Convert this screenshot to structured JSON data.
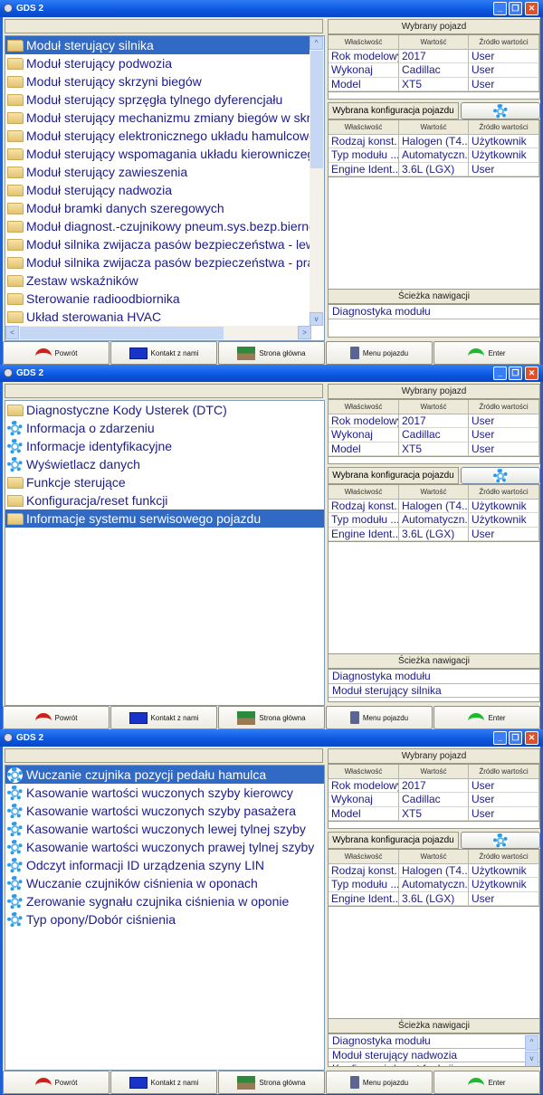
{
  "windows": [
    {
      "title": "GDS 2",
      "list_items": [
        {
          "label": "Moduł sterujący silnika",
          "icon": "folder-icon",
          "selected": true
        },
        {
          "label": "Moduł sterujący podwozia",
          "icon": "folder-icon"
        },
        {
          "label": "Moduł sterujący skrzyni biegów",
          "icon": "folder-icon"
        },
        {
          "label": "Moduł sterujący sprzęgła tylnego dyferencjału",
          "icon": "folder-icon"
        },
        {
          "label": "Moduł sterujący mechanizmu zmiany biegów w skrzyni",
          "icon": "folder-icon"
        },
        {
          "label": "Moduł sterujący elektronicznego układu hamulcowego",
          "icon": "folder-icon"
        },
        {
          "label": "Moduł sterujący wspomagania układu kierowniczego",
          "icon": "folder-icon"
        },
        {
          "label": "Moduł sterujący zawieszenia",
          "icon": "folder-icon"
        },
        {
          "label": "Moduł sterujący nadwozia",
          "icon": "folder-icon"
        },
        {
          "label": "Moduł bramki danych szeregowych",
          "icon": "folder-icon"
        },
        {
          "label": "Moduł diagnost.-czujnikowy pneum.sys.bezp.biernego",
          "icon": "folder-icon"
        },
        {
          "label": "Moduł silnika zwijacza pasów bezpieczeństwa - lewy",
          "icon": "folder-icon"
        },
        {
          "label": "Moduł silnika zwijacza pasów bezpieczeństwa - prawy",
          "icon": "folder-icon"
        },
        {
          "label": "Zestaw wskaźników",
          "icon": "folder-icon"
        },
        {
          "label": "Sterowanie radioodbiornika",
          "icon": "folder-icon"
        },
        {
          "label": "Układ sterowania HVAC",
          "icon": "folder-icon"
        }
      ],
      "scrollbars": true,
      "path_items": [
        "Diagnostyka modułu"
      ],
      "tooltip": ""
    },
    {
      "title": "GDS 2",
      "list_items": [
        {
          "label": "Diagnostyczne Kody Usterek (DTC)",
          "icon": "folder-icon"
        },
        {
          "label": "Informacja o zdarzeniu",
          "icon": "gear-icon"
        },
        {
          "label": "Informacje identyfikacyjne",
          "icon": "gear-icon"
        },
        {
          "label": "Wyświetlacz danych",
          "icon": "gear-icon"
        },
        {
          "label": "Funkcje sterujące",
          "icon": "folder-icon"
        },
        {
          "label": "Konfiguracja/reset funkcji",
          "icon": "folder-icon"
        },
        {
          "label": "Informacje systemu serwisowego pojazdu",
          "icon": "folder-icon",
          "selected": true
        }
      ],
      "scrollbars": false,
      "path_items": [
        "Diagnostyka modułu",
        "Moduł sterujący silnika"
      ],
      "tooltip": "GDS 2"
    },
    {
      "title": "GDS 2",
      "list_items": [
        {
          "label": "Wuczanie czujnika pozycji pedału hamulca",
          "icon": "gear-icon",
          "selected": true
        },
        {
          "label": "Kasowanie wartości wuczonych szyby kierowcy",
          "icon": "gear-icon"
        },
        {
          "label": "Kasowanie wartości wuczonych szyby pasażera",
          "icon": "gear-icon"
        },
        {
          "label": "Kasowanie wartości wuczonych lewej tylnej szyby",
          "icon": "gear-icon"
        },
        {
          "label": "Kasowanie wartości wuczonych prawej tylnej szyby",
          "icon": "gear-icon"
        },
        {
          "label": "Odczyt informacji ID urządzenia szyny LIN",
          "icon": "gear-icon"
        },
        {
          "label": "Wuczanie czujników ciśnienia w oponach",
          "icon": "gear-icon"
        },
        {
          "label": "Zerowanie sygnału czujnika ciśnienia w oponie",
          "icon": "gear-icon"
        },
        {
          "label": "Typ opony/Dobór ciśnienia",
          "icon": "gear-icon"
        }
      ],
      "scrollbars": false,
      "path_items": [
        "Diagnostyka modułu",
        "Moduł sterujący nadwozia",
        "Konfiguracja/reset funkcji"
      ],
      "path_scroll": true,
      "tooltip": ""
    }
  ],
  "vehicle": {
    "title": "Wybrany pojazd",
    "columns": [
      "Właściwość",
      "Wartość",
      "Źródło wartości"
    ],
    "rows": [
      [
        "Rok modelowy",
        "2017",
        "User"
      ],
      [
        "Wykonaj",
        "Cadillac",
        "User"
      ],
      [
        "Model",
        "XT5",
        "User"
      ]
    ]
  },
  "config": {
    "title": "Wybrana konfiguracja pojazdu",
    "columns": [
      "Właściwość",
      "Wartość",
      "Źródło wartości"
    ],
    "rows": [
      [
        "Rodzaj konst...",
        "Halogen (T4...",
        "Użytkownik"
      ],
      [
        "Typ modułu ...",
        "Automatyczn...",
        "Użytkownik"
      ],
      [
        "Engine Ident...",
        "3.6L (LGX)",
        "User"
      ]
    ]
  },
  "navigation": {
    "title": "Ścieżka nawigacji"
  },
  "buttons": [
    {
      "label": "Powrót",
      "icon": "back-arrow-icon"
    },
    {
      "label": "Kontakt z nami",
      "icon": "envelope-icon"
    },
    {
      "label": "Strona główna",
      "icon": "home-icon"
    },
    {
      "label": "Menu pojazdu",
      "icon": "vehicle-menu-icon"
    },
    {
      "label": "Enter",
      "icon": "enter-arrow-icon"
    }
  ],
  "colors": {
    "titlebar": "#0a56e0",
    "selection": "#316ac5",
    "text": "#1c1c8a"
  }
}
